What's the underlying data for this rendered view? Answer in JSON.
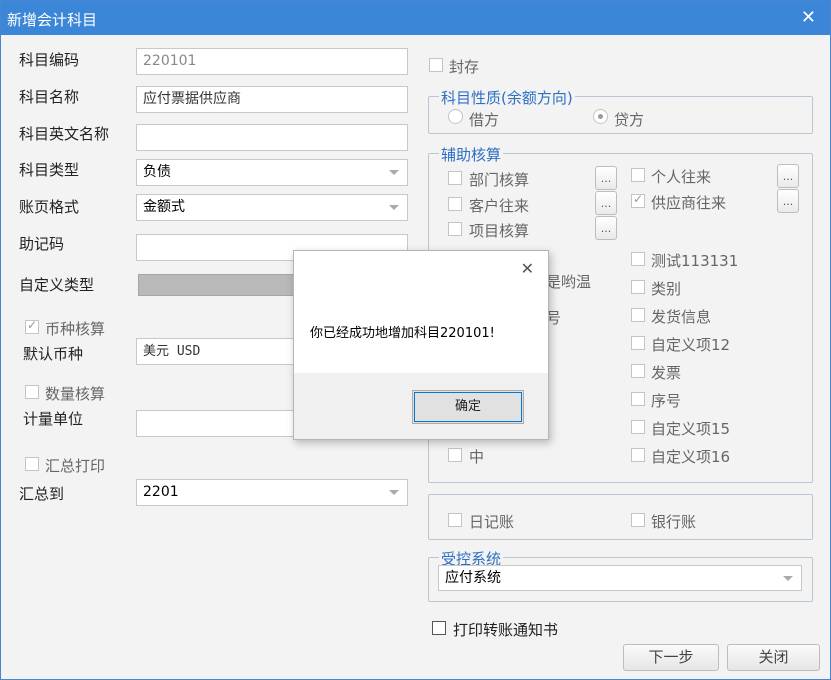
{
  "window": {
    "title": "新增会计科目",
    "close": "✕"
  },
  "left": {
    "code_label": "科目编码",
    "code_value": "220101",
    "name_label": "科目名称",
    "name_value": "应付票据供应商",
    "en_name_label": "科目英文名称",
    "en_name_value": "",
    "type_label": "科目类型",
    "type_value": "负债",
    "ledger_label": "账页格式",
    "ledger_value": "金额式",
    "memo_label": "助记码",
    "memo_value": "",
    "custom_type_label": "自定义类型",
    "currency_check_label": "币种核算",
    "currency_check": true,
    "default_currency_label": "默认币种",
    "default_currency_value": "美元 USD",
    "quantity_check_label": "数量核算",
    "quantity_check": false,
    "unit_label": "计量单位",
    "unit_value": "",
    "summary_print_label": "汇总打印",
    "summary_print": false,
    "summary_to_label": "汇总到",
    "summary_to_value": "2201"
  },
  "right": {
    "sealed_label": "封存",
    "sealed": false,
    "nature_group": "科目性质(余额方向)",
    "debit_label": "借方",
    "credit_label": "贷方",
    "selected": "credit",
    "aux_group": "辅助核算",
    "aux_left": [
      {
        "label": "部门核算",
        "checked": false
      },
      {
        "label": "客户往来",
        "checked": false
      },
      {
        "label": "项目核算",
        "checked": false
      }
    ],
    "aux_right": [
      {
        "label": "个人往来",
        "checked": false
      },
      {
        "label": "供应商往来",
        "checked": true
      }
    ],
    "aux_right_list": [
      "测试113131",
      "类别",
      "发货信息",
      "自定义项12",
      "发票",
      "序号",
      "自定义项15",
      "自定义项16"
    ],
    "partial_left_1": "是哟温",
    "partial_left_2": "号",
    "aux_left_bottom": "中",
    "journal_label": "日记账",
    "bank_label": "银行账",
    "controlled_group": "受控系统",
    "controlled_value": "应付系统",
    "print_notice_label": "打印转账通知书",
    "next_button": "下一步",
    "close_button": "关闭",
    "dots": "..."
  },
  "dialog": {
    "message": "你已经成功地增加科目220101!",
    "ok": "确定",
    "close": "✕"
  }
}
